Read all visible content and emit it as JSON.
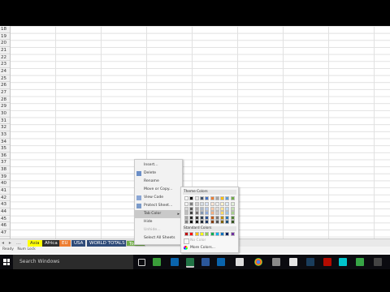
{
  "rows": [
    "18",
    "19",
    "20",
    "21",
    "22",
    "23",
    "24",
    "25",
    "26",
    "27",
    "28",
    "29",
    "30",
    "31",
    "32",
    "33",
    "34",
    "35",
    "36",
    "37",
    "38",
    "39",
    "40",
    "41",
    "42",
    "43",
    "44",
    "45",
    "46",
    "47"
  ],
  "sheet_tabs": [
    {
      "label": "Asia",
      "bg": "#ffff00",
      "fg": "#333333"
    },
    {
      "label": "Africa",
      "bg": "#2f2f2f",
      "fg": "#ffffff"
    },
    {
      "label": "EU",
      "bg": "#ed7d31",
      "fg": "#ffffff"
    },
    {
      "label": "USA",
      "bg": "#2e4a78",
      "fg": "#ffffff"
    },
    {
      "label": "WORLD TOTALS",
      "bg": "#2e4a78",
      "fg": "#ffffff"
    },
    {
      "label": "Totals",
      "bg": "#70ad47",
      "fg": "#ffffff"
    }
  ],
  "status": {
    "ready": "Ready",
    "num_lock": "Num Lock"
  },
  "taskbar": {
    "search_placeholder": "Search Windows"
  },
  "context_menu": {
    "items": [
      {
        "label": "Insert...",
        "disabled": false,
        "icon": ""
      },
      {
        "label": "Delete",
        "disabled": false,
        "icon": "delete-sheet-icon"
      },
      {
        "label": "Rename",
        "disabled": false,
        "icon": ""
      },
      {
        "label": "Move or Copy...",
        "disabled": false,
        "icon": ""
      },
      {
        "label": "View Code",
        "disabled": false,
        "icon": "view-code-icon"
      },
      {
        "label": "Protect Sheet...",
        "disabled": false,
        "icon": "protect-sheet-icon"
      },
      {
        "label": "Tab Color",
        "disabled": false,
        "highlighted": true,
        "submenu": true,
        "icon": ""
      },
      {
        "label": "Hide",
        "disabled": false,
        "icon": ""
      },
      {
        "label": "Unhide...",
        "disabled": true,
        "icon": ""
      },
      {
        "label": "Select All Sheets",
        "disabled": false,
        "icon": ""
      }
    ]
  },
  "tab_color_palette": {
    "theme_title": "Theme Colors",
    "standard_title": "Standard Colors",
    "no_color": "No Color",
    "more_colors": "More Colors...",
    "theme_top": [
      "#ffffff",
      "#000000",
      "#e7e6e6",
      "#44546a",
      "#4472c4",
      "#ed7d31",
      "#a5a5a5",
      "#ffc000",
      "#5b9bd5",
      "#70ad47"
    ],
    "theme_shades": [
      [
        "#f2f2f2",
        "#7f7f7f",
        "#d0cece",
        "#d6dce4",
        "#d9e2f3",
        "#fbe5d5",
        "#ededed",
        "#fff2cc",
        "#deebf6",
        "#e2efd9"
      ],
      [
        "#d8d8d8",
        "#595959",
        "#aeabab",
        "#adb9ca",
        "#b4c6e7",
        "#f7cbac",
        "#dbdbdb",
        "#fee599",
        "#bdd7ee",
        "#c5e0b3"
      ],
      [
        "#bfbfbf",
        "#3f3f3f",
        "#757070",
        "#8496b0",
        "#8eaadb",
        "#f4b183",
        "#c9c9c9",
        "#ffd965",
        "#9dc3e6",
        "#a8d08d"
      ],
      [
        "#a5a5a5",
        "#262626",
        "#3a3838",
        "#323f4f",
        "#2f5496",
        "#c55a11",
        "#7b7b7b",
        "#bf8f00",
        "#2e75b5",
        "#538135"
      ],
      [
        "#7f7f7f",
        "#0c0c0c",
        "#171616",
        "#222a35",
        "#1f3864",
        "#833c0b",
        "#525252",
        "#7f6000",
        "#1e4e79",
        "#375623"
      ]
    ],
    "standard": [
      "#c00000",
      "#ff0000",
      "#ffc000",
      "#ffff00",
      "#92d050",
      "#00b050",
      "#00b0f0",
      "#0070c0",
      "#002060",
      "#7030a0"
    ]
  },
  "colors": {
    "excel_green": "#217346",
    "taskbar_bg": "#0b0b10"
  }
}
